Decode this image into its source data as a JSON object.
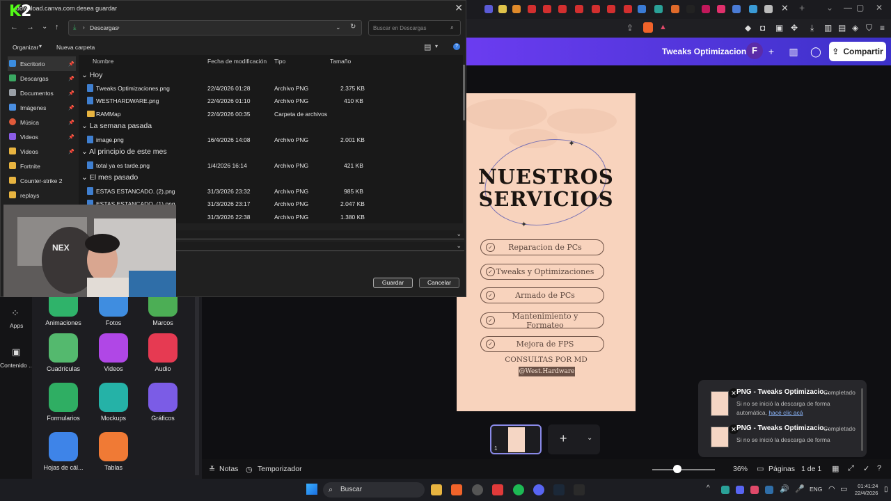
{
  "browser": {
    "address_partial": ""
  },
  "canva": {
    "design_title": "Tweaks Optimizaciones",
    "avatar_letter": "F",
    "share_label": "Compartir",
    "sidebar": [
      {
        "label": "Apps"
      },
      {
        "label": "Contenido ..."
      }
    ],
    "apps": [
      {
        "label": "Animaciones",
        "color": "#2fb36a"
      },
      {
        "label": "Fotos",
        "color": "#3f8de0"
      },
      {
        "label": "Marcos",
        "color": "#4cae55"
      },
      {
        "label": "Cuadrículas",
        "color": "#54b96e"
      },
      {
        "label": "Videos",
        "color": "#b047e6"
      },
      {
        "label": "Audio",
        "color": "#e63a52"
      },
      {
        "label": "Formularios",
        "color": "#2fae63"
      },
      {
        "label": "Mockups",
        "color": "#25b2a7"
      },
      {
        "label": "Gráficos",
        "color": "#7b5ce6"
      },
      {
        "label": "Hojas de cál...",
        "color": "#3e84e8"
      },
      {
        "label": "Tablas",
        "color": "#f07a35"
      }
    ],
    "design": {
      "heading_line1": "NUESTROS",
      "heading_line2": "SERVICIOS",
      "services": [
        "Reparacion de PCs",
        "Tweaks y Optimizaciones",
        "Armado de PCs",
        "Mantenimiento y Formateo",
        "Mejora de FPS"
      ],
      "consultas": "CONSULTAS POR MD",
      "handle": "@West.Hardware"
    },
    "page_number": "1",
    "bottom_bar": {
      "notes": "Notas",
      "timer": "Temporizador",
      "zoom": "36%",
      "pages": "Páginas",
      "page_of": "1 de 1"
    }
  },
  "dialog": {
    "title": "download.canva.com desea guardar",
    "path": [
      "Descargas"
    ],
    "search_placeholder": "Buscar en Descargas",
    "organize": "Organizar",
    "new_folder": "Nueva carpeta",
    "nav": [
      {
        "label": "Escritorio",
        "pinned": true,
        "color": "#3b8de0"
      },
      {
        "label": "Descargas",
        "pinned": true,
        "color": "#3aa862"
      },
      {
        "label": "Documentos",
        "pinned": true,
        "color": "#9aa0a6"
      },
      {
        "label": "Imágenes",
        "pinned": true,
        "color": "#4a8ee0"
      },
      {
        "label": "Música",
        "pinned": true,
        "color": "#e05a3a"
      },
      {
        "label": "Videos",
        "pinned": true,
        "color": "#8b5ce6"
      },
      {
        "label": "Videos",
        "pinned": true,
        "color": "#e8b440"
      },
      {
        "label": "Fortnite",
        "pinned": false,
        "color": "#e8b440"
      },
      {
        "label": "Counter-strike 2",
        "pinned": false,
        "color": "#e8b440"
      },
      {
        "label": "replays",
        "pinned": false,
        "color": "#e8b440"
      }
    ],
    "columns": {
      "name": "Nombre",
      "date": "Fecha de modificación",
      "type": "Tipo",
      "size": "Tamaño"
    },
    "groups": [
      {
        "label": "Hoy",
        "files": [
          {
            "name": "Tweaks Optimizaciones.png",
            "date": "22/4/2026 01:28",
            "type": "Archivo PNG",
            "size": "2.375 KB"
          },
          {
            "name": "WESTHARDWARE.png",
            "date": "22/4/2026 01:10",
            "type": "Archivo PNG",
            "size": "410 KB"
          },
          {
            "name": "RAMMap",
            "date": "22/4/2026 00:35",
            "type": "Carpeta de archivos",
            "size": ""
          }
        ]
      },
      {
        "label": "La semana pasada",
        "files": [
          {
            "name": "image.png",
            "date": "16/4/2026 14:08",
            "type": "Archivo PNG",
            "size": "2.001 KB"
          }
        ]
      },
      {
        "label": "Al principio de este mes",
        "files": [
          {
            "name": "total ya es tarde.png",
            "date": "1/4/2026 16:14",
            "type": "Archivo PNG",
            "size": "421 KB"
          }
        ]
      },
      {
        "label": "El mes pasado",
        "files": [
          {
            "name": "ESTAS ESTANCADO. (2).png",
            "date": "31/3/2026 23:32",
            "type": "Archivo PNG",
            "size": "985 KB"
          },
          {
            "name": "ESTAS ESTANCADO. (1).png",
            "date": "31/3/2026 23:17",
            "type": "Archivo PNG",
            "size": "2.047 KB"
          },
          {
            "name": "",
            "date": "31/3/2026 22:38",
            "type": "Archivo PNG",
            "size": "1.380 KB"
          }
        ]
      }
    ],
    "save_label": "Guardar",
    "cancel_label": "Cancelar"
  },
  "overlay": {
    "logo": "K2"
  },
  "downloads": [
    {
      "title": "PNG - Tweaks Optimizacio...",
      "status": "Completado",
      "msg": "Si no se inició la descarga de forma automática,",
      "link": "hacé clic acá"
    },
    {
      "title": "PNG - Tweaks Optimizacio...",
      "status": "Completado",
      "msg": "Si no se inició la descarga de forma",
      "link": ""
    }
  ],
  "taskbar": {
    "search": "Buscar",
    "lang": "ENG",
    "time": "01:41:24",
    "date": "22/4/2026"
  }
}
